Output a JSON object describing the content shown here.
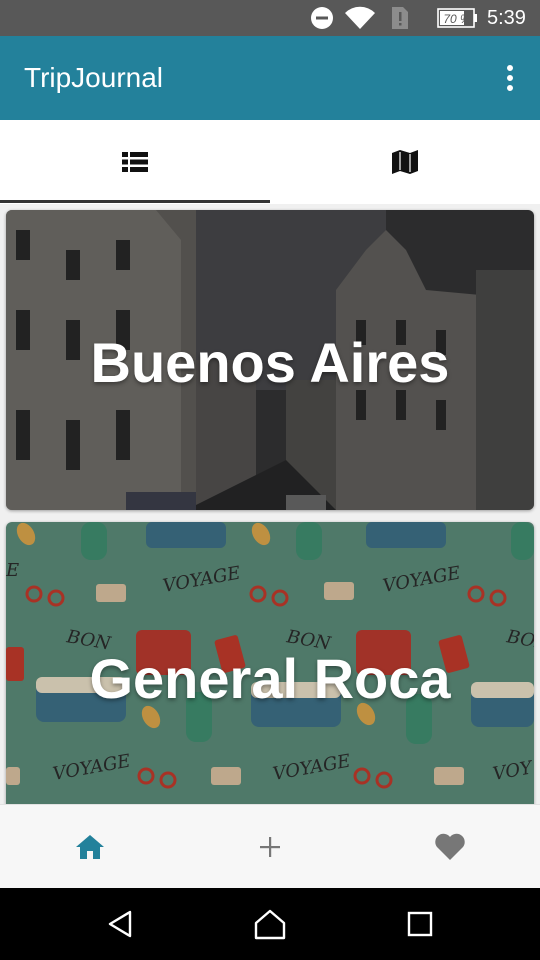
{
  "status_bar": {
    "battery_percent": "70 %",
    "time": "5:39",
    "icons": [
      "do-not-disturb-icon",
      "wifi-icon",
      "no-sim-icon",
      "battery-icon"
    ]
  },
  "app_bar": {
    "title": "TripJournal",
    "background_color": "#23819b",
    "menu_icon": "overflow-menu-icon"
  },
  "tabs": [
    {
      "name": "list",
      "icon": "list-view-icon",
      "selected": true
    },
    {
      "name": "map",
      "icon": "map-icon",
      "selected": false
    }
  ],
  "trips": [
    {
      "title": "Buenos Aires",
      "background": "city-street-photo"
    },
    {
      "title": "General Roca",
      "background": "travel-pattern-illustration"
    }
  ],
  "bottom_nav": [
    {
      "name": "home",
      "icon": "home-icon",
      "active": true,
      "color": "#23819b"
    },
    {
      "name": "add",
      "icon": "plus-icon",
      "active": false,
      "color": "#777777"
    },
    {
      "name": "favorites",
      "icon": "heart-icon",
      "active": false,
      "color": "#777777"
    }
  ],
  "system_nav": [
    "back-icon",
    "home-circle-icon",
    "recent-apps-icon"
  ]
}
